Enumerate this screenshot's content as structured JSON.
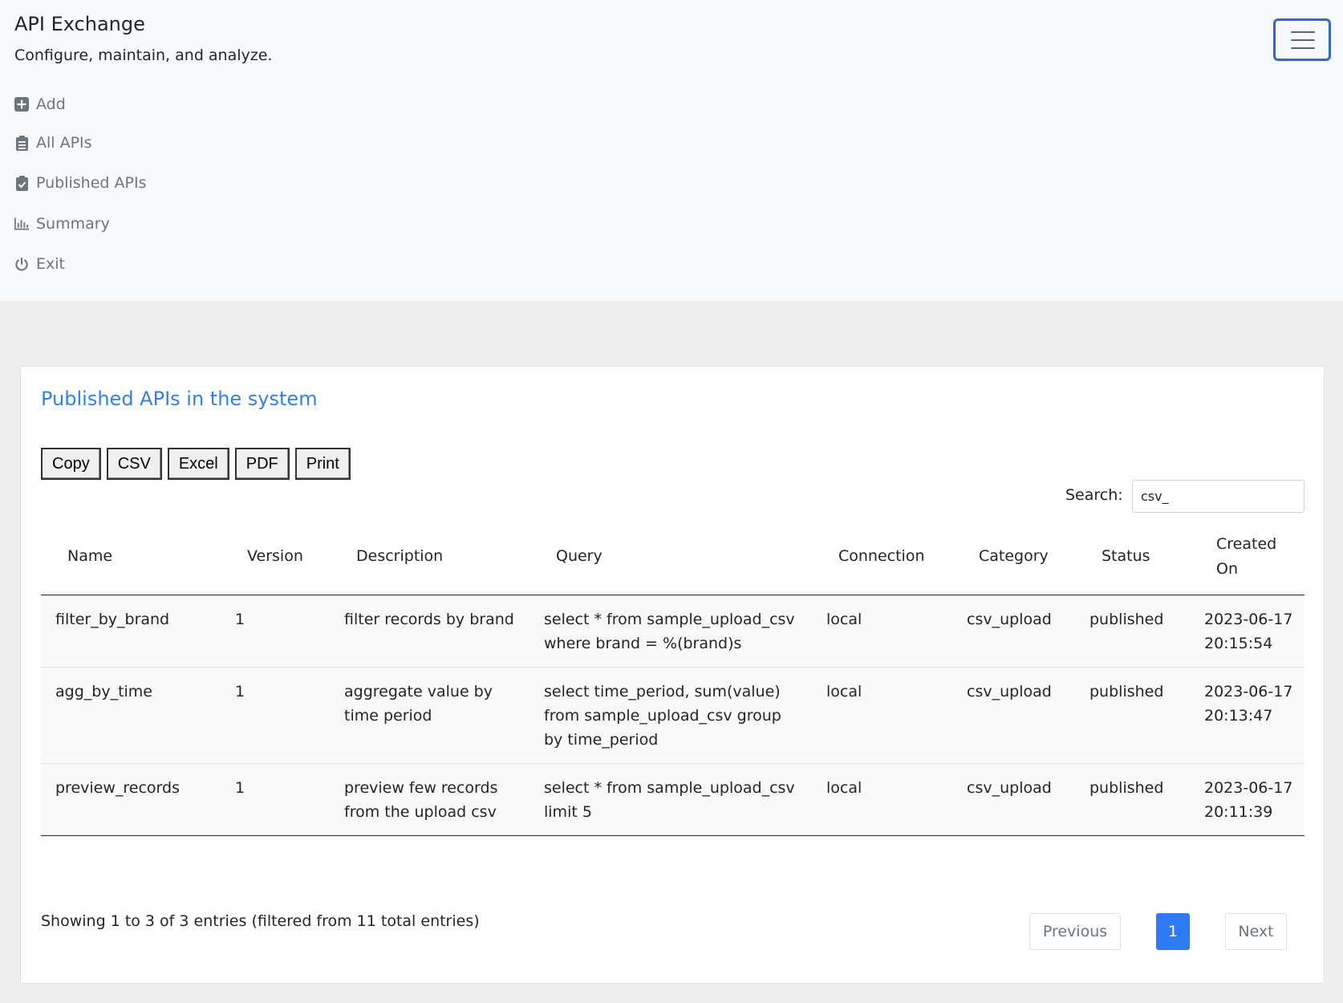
{
  "header": {
    "brand": "API Exchange",
    "tagline": "Configure, maintain, and analyze.",
    "toggler_icon": "hamburger-icon"
  },
  "nav": {
    "items": [
      {
        "label": "Add",
        "icon": "plus-square-icon"
      },
      {
        "label": "All APIs",
        "icon": "clipboard-list-icon"
      },
      {
        "label": "Published APIs",
        "icon": "clipboard-check-icon"
      },
      {
        "label": "Summary",
        "icon": "bar-chart-icon"
      },
      {
        "label": "Exit",
        "icon": "power-icon"
      }
    ]
  },
  "card": {
    "title": "Published APIs in the system",
    "title_color": "#2f80ed"
  },
  "export_buttons": [
    "Copy",
    "CSV",
    "Excel",
    "PDF",
    "Print"
  ],
  "search": {
    "label": "Search:",
    "value": "csv_"
  },
  "table": {
    "columns": [
      "Name",
      "Version",
      "Description",
      "Query",
      "Connection",
      "Category",
      "Status",
      "Created On"
    ],
    "rows": [
      [
        "filter_by_brand",
        "1",
        "filter records by brand",
        "select * from sample_upload_csv where brand = %(brand)s",
        "local",
        "csv_upload",
        "published",
        "2023-06-17 20:15:54"
      ],
      [
        "agg_by_time",
        "1",
        "aggregate value by time period",
        "select time_period, sum(value) from sample_upload_csv group by time_period",
        "local",
        "csv_upload",
        "published",
        "2023-06-17 20:13:47"
      ],
      [
        "preview_records",
        "1",
        "preview few records from the upload csv",
        "select * from sample_upload_csv limit 5",
        "local",
        "csv_upload",
        "published",
        "2023-06-17 20:11:39"
      ]
    ]
  },
  "footer": {
    "info": "Showing 1 to 3 of 3 entries (filtered from 11 total entries)",
    "previous": "Previous",
    "page": "1",
    "next": "Next"
  },
  "colors": {
    "accent": "#2f7bf6",
    "toggler_border": "#3367d6"
  }
}
